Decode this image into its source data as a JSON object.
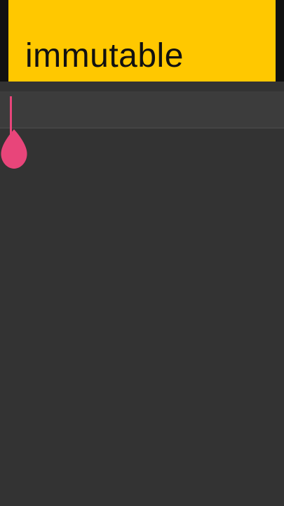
{
  "banner": {
    "word": "immutable"
  },
  "colors": {
    "banner_bg": "#ffc800",
    "page_bg": "#333333",
    "playhead": "#e8457a"
  },
  "icons": {
    "playhead_handle": "playhead-drop-icon"
  }
}
